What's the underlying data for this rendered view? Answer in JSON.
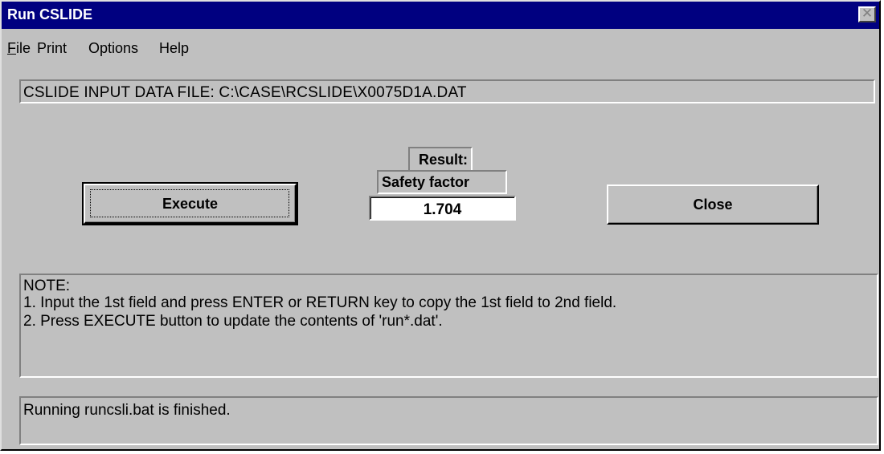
{
  "window": {
    "title": "Run CSLIDE",
    "close_glyph": "✕"
  },
  "menu": {
    "items": [
      {
        "label_first": "F",
        "label_rest": "ile"
      },
      {
        "label": "Print"
      },
      {
        "label": "Options"
      },
      {
        "label": "Help"
      }
    ]
  },
  "input_file": {
    "text": "CSLIDE INPUT DATA FILE: C:\\CASE\\RCSLIDE\\X0075D1A.DAT"
  },
  "buttons": {
    "execute_label": "Execute",
    "close_label": "Close"
  },
  "result": {
    "label": "Result:",
    "safety_factor_label": "Safety factor",
    "safety_factor_value": "1.704"
  },
  "note": {
    "lines": [
      "NOTE:",
      "1. Input the 1st field and press ENTER or RETURN key to copy the 1st field to 2nd field.",
      "2. Press EXECUTE button to update the contents of 'run*.dat'."
    ]
  },
  "status": {
    "text": "Running runcsli.bat is finished."
  },
  "colors": {
    "titlebar": "#000080",
    "face": "#c0c0c0",
    "field": "#ffffff"
  },
  "icons": {
    "close": "close-icon"
  }
}
